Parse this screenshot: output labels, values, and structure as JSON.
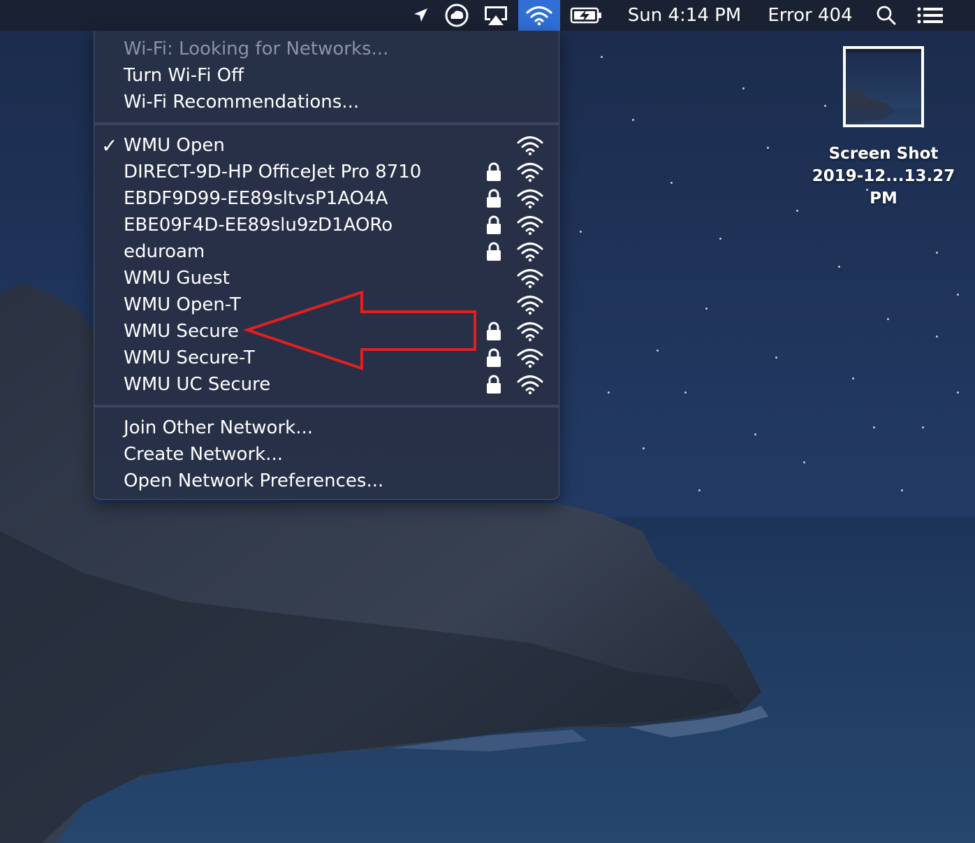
{
  "menubar": {
    "icons": [
      "location-arrow-icon",
      "creative-cloud-icon",
      "airplay-icon",
      "wifi-icon",
      "battery-charging-icon",
      "search-icon",
      "notification-center-icon"
    ],
    "clock": "Sun 4:14 PM",
    "user": "Error 404",
    "accent_color": "#2f6fd6"
  },
  "wifi_menu": {
    "status": "Wi-Fi: Looking for Networks...",
    "turn_off": "Turn Wi-Fi Off",
    "recommendations": "Wi-Fi Recommendations...",
    "checkmark": "✓",
    "networks": [
      {
        "name": "WMU Open",
        "selected": true,
        "secured": false
      },
      {
        "name": "DIRECT-9D-HP OfficeJet Pro 8710",
        "selected": false,
        "secured": true
      },
      {
        "name": "EBDF9D99-EE89sltvsP1AO4A",
        "selected": false,
        "secured": true
      },
      {
        "name": "EBE09F4D-EE89slu9zD1AORo",
        "selected": false,
        "secured": true
      },
      {
        "name": "eduroam",
        "selected": false,
        "secured": true
      },
      {
        "name": "WMU Guest",
        "selected": false,
        "secured": false
      },
      {
        "name": "WMU Open-T",
        "selected": false,
        "secured": false
      },
      {
        "name": "WMU Secure",
        "selected": false,
        "secured": true
      },
      {
        "name": "WMU Secure-T",
        "selected": false,
        "secured": true
      },
      {
        "name": "WMU UC Secure",
        "selected": false,
        "secured": true
      }
    ],
    "join_other": "Join Other Network...",
    "create_network": "Create Network...",
    "open_prefs": "Open Network Preferences..."
  },
  "annotation": {
    "color": "#e02020",
    "points_to": "WMU Secure"
  },
  "desktop": {
    "file_name_line1": "Screen Shot",
    "file_name_line2": "2019-12...13.27 PM"
  }
}
